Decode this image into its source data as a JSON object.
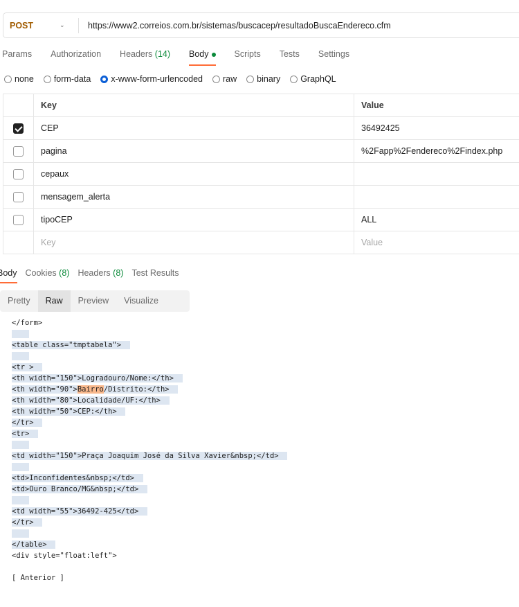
{
  "request": {
    "method": "POST",
    "url": "https://www2.correios.com.br/sistemas/buscacep/resultadoBuscaEndereco.cfm"
  },
  "request_tabs": [
    {
      "label": "Params"
    },
    {
      "label": "Authorization"
    },
    {
      "label": "Headers",
      "count": "(14)"
    },
    {
      "label": "Body"
    },
    {
      "label": "Scripts"
    },
    {
      "label": "Tests"
    },
    {
      "label": "Settings"
    }
  ],
  "body_types": [
    "none",
    "form-data",
    "x-www-form-urlencoded",
    "raw",
    "binary",
    "GraphQL"
  ],
  "selected_body_type": "x-www-form-urlencoded",
  "params_table": {
    "headers": {
      "key": "Key",
      "value": "Value"
    },
    "rows": [
      {
        "key": "CEP",
        "value": "36492425",
        "checked": true
      },
      {
        "key": "pagina",
        "value": "%2Fapp%2Fendereco%2Findex.php",
        "checked": false
      },
      {
        "key": "cepaux",
        "value": "",
        "checked": false
      },
      {
        "key": "mensagem_alerta",
        "value": "",
        "checked": false
      },
      {
        "key": "tipoCEP",
        "value": "ALL",
        "checked": false
      }
    ],
    "placeholder": {
      "key": "Key",
      "value": "Value"
    }
  },
  "response_tabs": [
    {
      "label": "Body"
    },
    {
      "label": "Cookies",
      "count": "(8)"
    },
    {
      "label": "Headers",
      "count": "(8)"
    },
    {
      "label": "Test Results"
    }
  ],
  "view_tabs": [
    "Pretty",
    "Raw",
    "Preview",
    "Visualize"
  ],
  "active_view": "Raw",
  "code_lines": [
    "</form>",
    "",
    "<table class=\"tmptabela\">",
    "",
    "<tr >",
    "<th width=\"150\">Logradouro/Nome:</th>",
    "<th width=\"90\">Bairro/Distrito:</th>",
    "<th width=\"80\">Localidade/UF:</th>",
    "<th width=\"50\">CEP:</th>",
    "</tr>",
    "<tr>",
    "",
    "<td width=\"150\">Praça Joaquim José da Silva Xavier&nbsp;</td>",
    "",
    "<td>Inconfidentes&nbsp;</td>",
    "<td>Ouro Branco/MG&nbsp;</td>",
    "",
    "<td width=\"55\">36492-425</td>",
    "</tr>",
    "",
    "</table>",
    "<div style=\"float:left\">",
    "",
    "[ Anterior ]"
  ],
  "search_highlight": "Bairro",
  "colors": {
    "method": "#a15c00",
    "accent": "#ff6c37",
    "count": "#0b8a3a",
    "radio": "#0c5fd6",
    "selection": "#dde6f1",
    "highlight": "#f8b88c"
  }
}
